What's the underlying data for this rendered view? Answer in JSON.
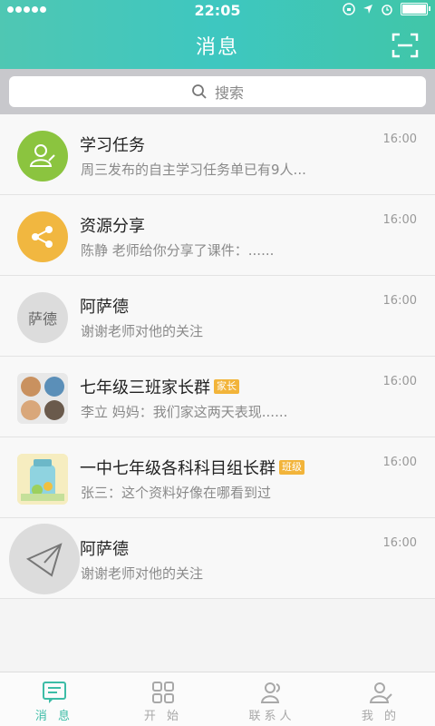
{
  "status_bar": {
    "time": "22:05"
  },
  "header": {
    "title": "消息"
  },
  "search": {
    "placeholder": "搜索"
  },
  "colors": {
    "accent": "#3ec7b3",
    "tag": "#f2b43a"
  },
  "messages": [
    {
      "avatar_icon": "user-edit-icon",
      "title": "学习任务",
      "tag": "",
      "preview": "周三发布的自主学习任务单已有9人...",
      "time": "16:00"
    },
    {
      "avatar_icon": "share-icon",
      "title": "资源分享",
      "tag": "",
      "preview": "陈静 老师给你分享了课件：......",
      "time": "16:00"
    },
    {
      "avatar_text": "萨德",
      "title": "阿萨德",
      "tag": "",
      "preview": "谢谢老师对他的关注",
      "time": "16:00"
    },
    {
      "avatar_icon": "group-photo-icon",
      "title": "七年级三班家长群",
      "tag": "家长",
      "preview": "李立 妈妈：我们家这两天表现......",
      "time": "16:00"
    },
    {
      "avatar_icon": "group-illustration-icon",
      "title": "一中七年级各科科目组长群",
      "tag": "班级",
      "preview": "张三：这个资料好像在哪看到过",
      "time": "16:00"
    },
    {
      "avatar_icon": "paper-plane-icon",
      "title": "阿萨德",
      "tag": "",
      "preview": "谢谢老师对他的关注",
      "time": "16:00"
    }
  ],
  "tabs": [
    {
      "label": "消 息",
      "icon": "message-icon",
      "active": true
    },
    {
      "label": "开 始",
      "icon": "grid-icon",
      "active": false
    },
    {
      "label": "联系人",
      "icon": "contacts-icon",
      "active": false
    },
    {
      "label": "我 的",
      "icon": "profile-icon",
      "active": false
    }
  ]
}
